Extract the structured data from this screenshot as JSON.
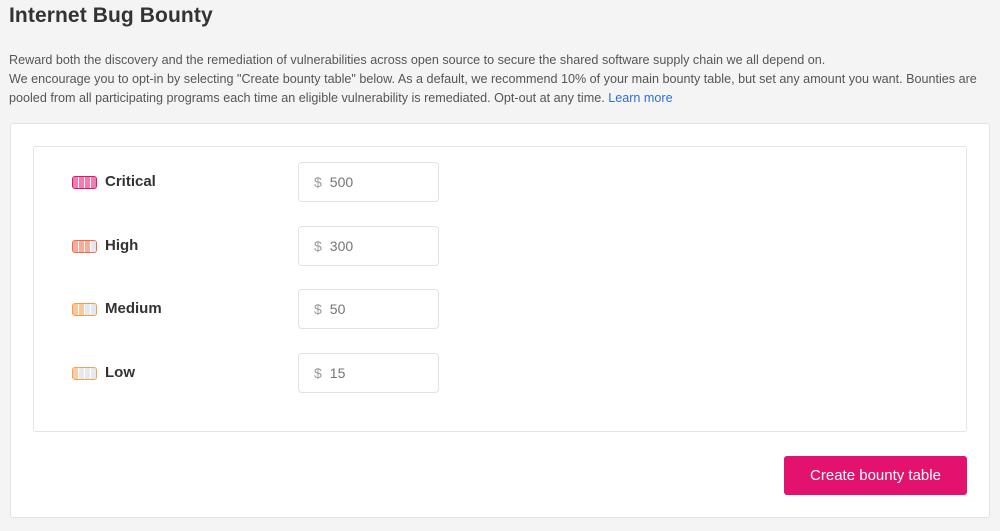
{
  "page": {
    "title": "Internet Bug Bounty",
    "description_line1": "Reward both the discovery and the remediation of vulnerabilities across open source to secure the shared software supply chain we all depend on.",
    "description_line2": "We encourage you to opt-in by selecting \"Create bounty table\" below. As a default, we recommend 10% of your main bounty table, but set any amount you want. Bounties are pooled from all participating programs each time an eligible vulnerability is remediated. Opt-out at any time.",
    "learn_more": "Learn more"
  },
  "bounty_table": {
    "currency_symbol": "$",
    "rows": [
      {
        "label": "Critical",
        "placeholder": "500",
        "icon": "severity-critical-icon",
        "color": "#e4126f",
        "filled_segments": 4
      },
      {
        "label": "High",
        "placeholder": "300",
        "icon": "severity-high-icon",
        "color": "#f06a4a",
        "filled_segments": 3
      },
      {
        "label": "Medium",
        "placeholder": "50",
        "icon": "severity-medium-icon",
        "color": "#f29b4a",
        "filled_segments": 2
      },
      {
        "label": "Low",
        "placeholder": "15",
        "icon": "severity-low-icon",
        "color": "#f0a45a",
        "filled_segments": 1
      }
    ]
  },
  "actions": {
    "create_label": "Create bounty table",
    "create_color": "#e4126f"
  },
  "colors": {
    "link": "#2f6fd3",
    "background": "#f4f4f4",
    "empty_segment": "#e6e8ef"
  }
}
